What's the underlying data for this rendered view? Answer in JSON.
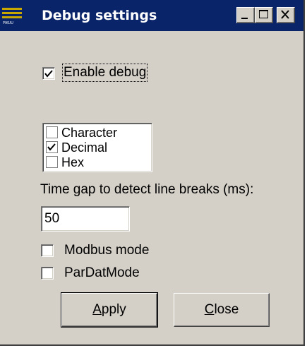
{
  "window": {
    "title": "Debug settings",
    "app_icon": "pikuu-app-icon",
    "app_icon_text": "PIKUU",
    "controls": {
      "minimize": "minimize-icon",
      "maximize": "maximize-icon",
      "close": "close-icon"
    }
  },
  "enable_debug": {
    "label": "Enable debug",
    "checked": true
  },
  "format_list": {
    "items": [
      {
        "label": "Character",
        "checked": false
      },
      {
        "label": "Decimal",
        "checked": true
      },
      {
        "label": "Hex",
        "checked": false
      }
    ]
  },
  "time_gap": {
    "label": "Time gap to detect line breaks (ms):",
    "value": "50"
  },
  "modbus_mode": {
    "label": "Modbus mode",
    "checked": false
  },
  "pardat_mode": {
    "label": "ParDatMode",
    "checked": false
  },
  "buttons": {
    "apply": {
      "mnemonic": "A",
      "rest": "pply"
    },
    "close": {
      "mnemonic": "C",
      "rest": "lose"
    }
  },
  "colors": {
    "titlebar": "#0a246a",
    "face": "#d4d0c8",
    "icon_lines": "#c8a800"
  }
}
